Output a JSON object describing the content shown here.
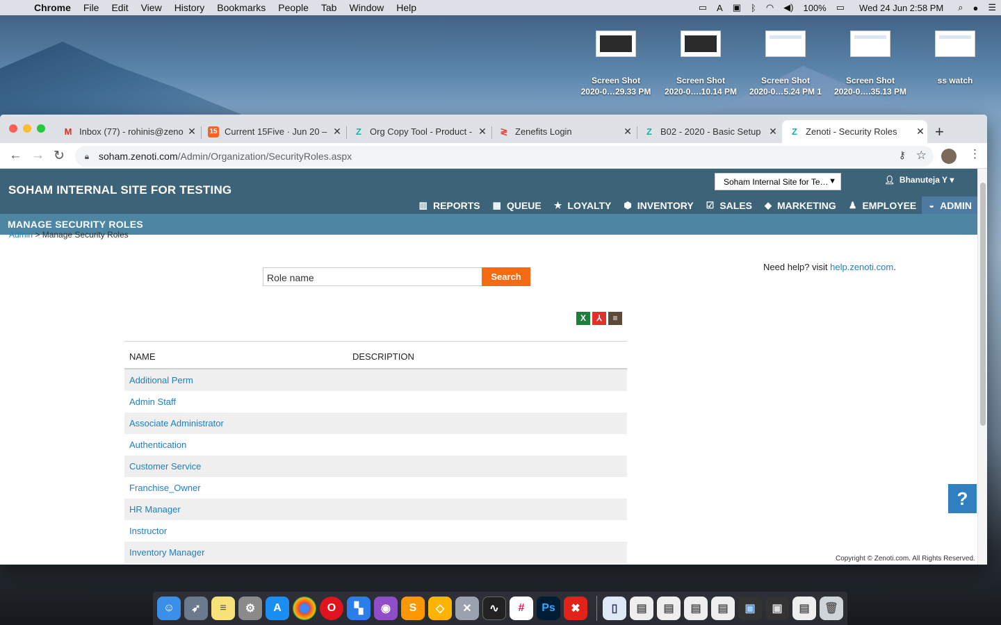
{
  "menubar": {
    "app": "Chrome",
    "items": [
      "File",
      "Edit",
      "View",
      "History",
      "Bookmarks",
      "People",
      "Tab",
      "Window",
      "Help"
    ],
    "battery": "100%",
    "clock": "Wed 24 Jun  2:58 PM"
  },
  "desktop": {
    "icons": [
      {
        "line1": "Screen Shot",
        "line2": "2020-0…29.33 PM"
      },
      {
        "line1": "Screen Shot",
        "line2": "2020-0….10.14 PM"
      },
      {
        "line1": "Screen Shot",
        "line2": "2020-0…5.24 PM 1"
      },
      {
        "line1": "Screen Shot",
        "line2": "2020-0….35.13 PM"
      },
      {
        "line1": "ss watch",
        "line2": ""
      }
    ]
  },
  "browser": {
    "tabs": [
      {
        "title": "Inbox (77) - rohinis@zeno",
        "fav": "M",
        "favColor": "#d93025"
      },
      {
        "title": "Current 15Five · Jun 20 – ",
        "fav": "15",
        "favColor": "#f26522"
      },
      {
        "title": "Org Copy Tool - Product -",
        "fav": "Z",
        "favColor": "#17b3a3"
      },
      {
        "title": "Zenefits Login",
        "fav": "≷",
        "favColor": "#e24b3b"
      },
      {
        "title": "B02 - 2020 - Basic Setup",
        "fav": "Z",
        "favColor": "#17b3a3"
      },
      {
        "title": "Zenoti - Security Roles",
        "fav": "Z",
        "favColor": "#17b3a3"
      }
    ],
    "url_host": "soham.zenoti.com",
    "url_path": "/Admin/Organization/SecurityRoles.aspx"
  },
  "app": {
    "site_name": "SOHAM INTERNAL SITE FOR TESTING",
    "center_select": "Soham Internal Site for Te…",
    "user": "Bhanuteja Y",
    "nav": [
      {
        "label": "REPORTS",
        "icon": "bar-chart-icon",
        "glyph": "▥"
      },
      {
        "label": "QUEUE",
        "icon": "calendar-icon",
        "glyph": "▦"
      },
      {
        "label": "LOYALTY",
        "icon": "star-icon",
        "glyph": "★"
      },
      {
        "label": "INVENTORY",
        "icon": "cube-icon",
        "glyph": "⬢"
      },
      {
        "label": "SALES",
        "icon": "checkbox-icon",
        "glyph": "☑"
      },
      {
        "label": "MARKETING",
        "icon": "tag-icon",
        "glyph": "◆"
      },
      {
        "label": "EMPLOYEE",
        "icon": "person-icon",
        "glyph": "♟"
      },
      {
        "label": "ADMIN",
        "icon": "dashboard-icon",
        "glyph": "◒"
      }
    ],
    "page_title": "MANAGE SECURITY ROLES",
    "breadcrumb_root": "Admin",
    "breadcrumb_sep": " > ",
    "breadcrumb_current": "Manage Security Roles",
    "search_value": "Role name",
    "search_button": "Search",
    "help_prefix": "Need help? visit ",
    "help_link": "help.zenoti.com",
    "help_suffix": ".",
    "table": {
      "headers": [
        "NAME",
        "DESCRIPTION"
      ],
      "rows": [
        "Additional Perm",
        "Admin Staff",
        "Associate Administrator",
        "Authentication",
        "Customer Service",
        "Franchise_Owner",
        "HR Manager",
        "Instructor",
        "Inventory Manager"
      ]
    },
    "help_float": "?",
    "copyright": "Copyright © Zenoti.com. All Rights Reserved."
  }
}
